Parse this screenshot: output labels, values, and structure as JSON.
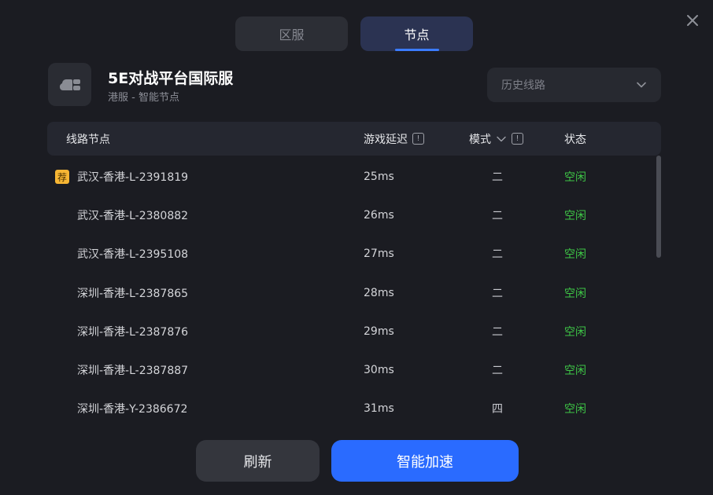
{
  "tabs": [
    {
      "label": "区服",
      "active": false
    },
    {
      "label": "节点",
      "active": true
    }
  ],
  "game": {
    "title": "5E对战平台国际服",
    "subtitle": "港服 - 智能节点"
  },
  "history": {
    "placeholder": "历史线路"
  },
  "table": {
    "headers": {
      "node": "线路节点",
      "latency": "游戏延迟",
      "mode": "模式",
      "status": "状态"
    },
    "rows": [
      {
        "name": "武汉-香港-L-2391819",
        "latency": "25ms",
        "mode": "二",
        "status": "空闲",
        "recommended": true,
        "badge": "荐"
      },
      {
        "name": "武汉-香港-L-2380882",
        "latency": "26ms",
        "mode": "二",
        "status": "空闲"
      },
      {
        "name": "武汉-香港-L-2395108",
        "latency": "27ms",
        "mode": "二",
        "status": "空闲"
      },
      {
        "name": "深圳-香港-L-2387865",
        "latency": "28ms",
        "mode": "二",
        "status": "空闲"
      },
      {
        "name": "深圳-香港-L-2387876",
        "latency": "29ms",
        "mode": "二",
        "status": "空闲"
      },
      {
        "name": "深圳-香港-L-2387887",
        "latency": "30ms",
        "mode": "二",
        "status": "空闲"
      },
      {
        "name": "深圳-香港-Y-2386672",
        "latency": "31ms",
        "mode": "四",
        "status": "空闲"
      }
    ]
  },
  "buttons": {
    "refresh": "刷新",
    "accelerate": "智能加速"
  },
  "colors": {
    "accent": "#2a6bff",
    "status_idle": "#3ec646",
    "badge": "#f7b634"
  }
}
